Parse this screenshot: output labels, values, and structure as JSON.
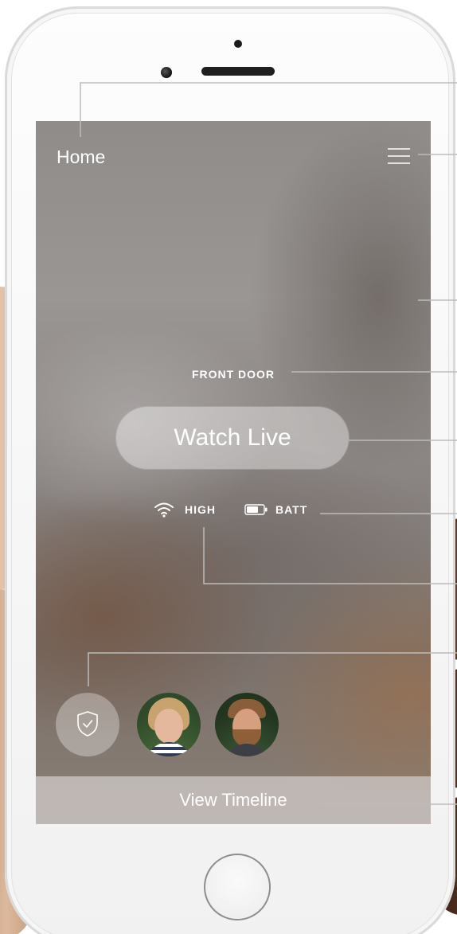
{
  "header": {
    "title": "Home",
    "menu_icon": "hamburger-menu-icon"
  },
  "camera": {
    "name": "FRONT DOOR",
    "watch_label": "Watch Live"
  },
  "status": {
    "signal_icon": "wifi-icon",
    "signal_label": "HIGH",
    "battery_icon": "battery-icon",
    "battery_label": "BATT",
    "battery_level_fraction": 0.7
  },
  "quick_access": {
    "mode_icon": "shield-check-icon",
    "users": [
      {
        "avatar": "woman-blonde-avatar"
      },
      {
        "avatar": "man-bearded-avatar"
      }
    ]
  },
  "footer": {
    "timeline_label": "View Timeline"
  },
  "colors": {
    "screen_text": "#ffffff",
    "callout_line": "#b8b8b8",
    "device_body": "#f4f4f4"
  }
}
